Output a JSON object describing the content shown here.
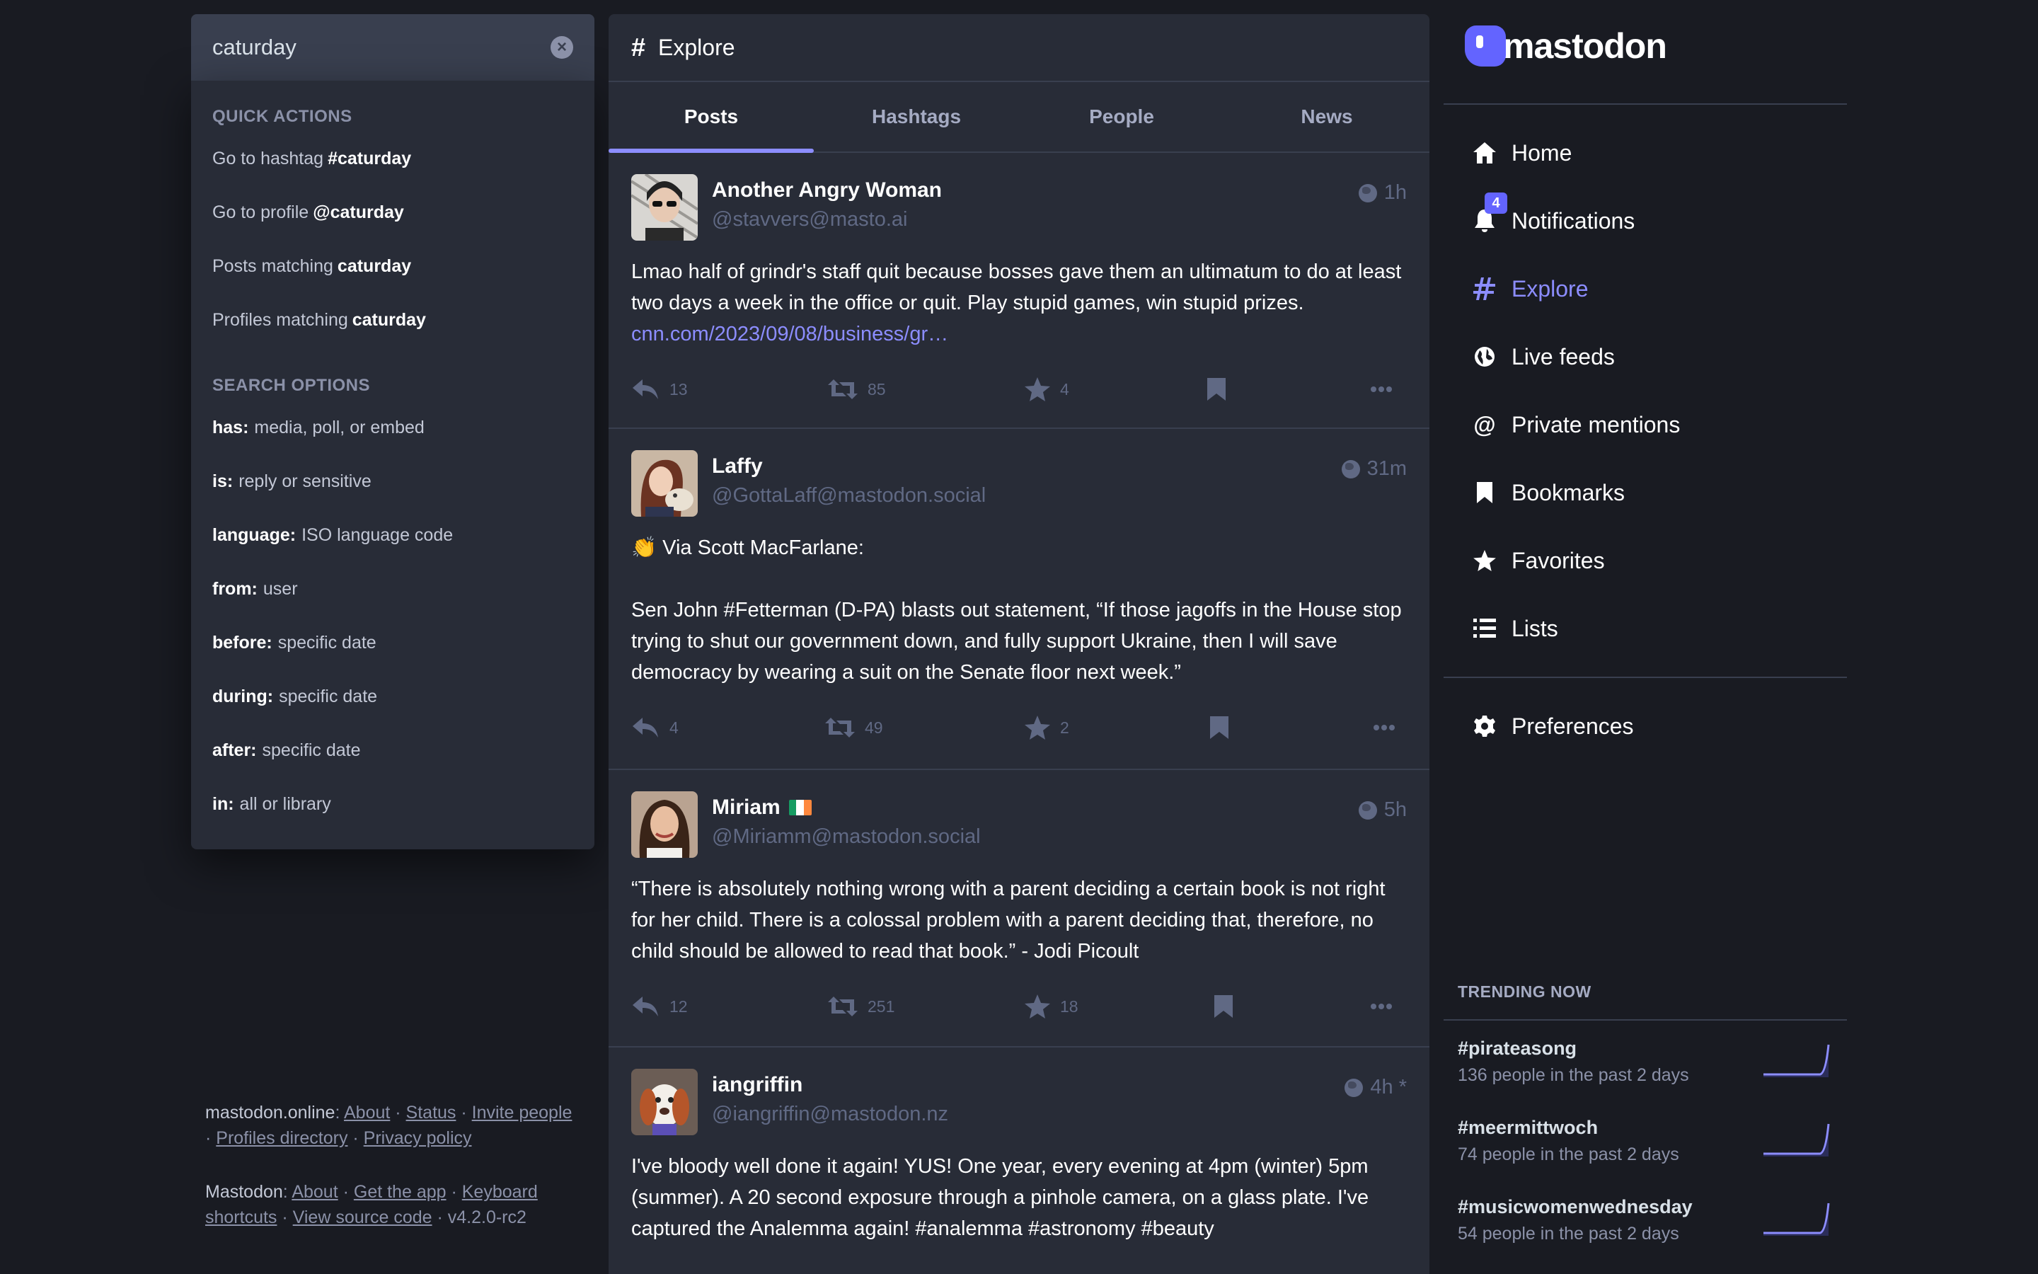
{
  "search": {
    "value": "caturday",
    "quick_actions_heading": "QUICK ACTIONS",
    "quick_actions": [
      {
        "prefix": "Go to hashtag",
        "term": "#caturday"
      },
      {
        "prefix": "Go to profile",
        "term": "@caturday"
      },
      {
        "prefix": "Posts matching",
        "term": "caturday"
      },
      {
        "prefix": "Profiles matching",
        "term": "caturday"
      }
    ],
    "options_heading": "SEARCH OPTIONS",
    "options": [
      {
        "key": "has:",
        "desc": "media, poll, or embed"
      },
      {
        "key": "is:",
        "desc": "reply or sensitive"
      },
      {
        "key": "language:",
        "desc": "ISO language code"
      },
      {
        "key": "from:",
        "desc": "user"
      },
      {
        "key": "before:",
        "desc": "specific date"
      },
      {
        "key": "during:",
        "desc": "specific date"
      },
      {
        "key": "after:",
        "desc": "specific date"
      },
      {
        "key": "in:",
        "desc": "all or library"
      }
    ]
  },
  "footer": {
    "server": "mastodon.online",
    "about": "About",
    "status": "Status",
    "invite": "Invite people",
    "profiles_directory": "Profiles directory",
    "privacy": "Privacy policy",
    "mastodon": "Mastodon",
    "about2": "About",
    "get_app": "Get the app",
    "shortcuts": "Keyboard shortcuts",
    "source": "View source code",
    "version": "v4.2.0-rc2"
  },
  "explore": {
    "title": "Explore",
    "tabs": [
      "Posts",
      "Hashtags",
      "People",
      "News"
    ]
  },
  "posts": [
    {
      "name": "Another Angry Woman",
      "handle": "@stavvers@masto.ai",
      "time": "1h",
      "content": "Lmao half of grindr's staff quit because bosses gave them an ultimatum to do at least two days a week in the office or quit. Play stupid games, win stupid prizes.",
      "link": "cnn.com/2023/09/08/business/gr…",
      "replies": "13",
      "boosts": "85",
      "favs": "4"
    },
    {
      "name": "Laffy",
      "handle": "@GottaLaff@mastodon.social",
      "time": "31m",
      "content_intro": "👏 Via Scott MacFarlane:",
      "content_a": "Sen John ",
      "content_tag": "#Fetterman",
      "content_b": " (D-PA) blasts out statement, “If those jagoffs in the House stop trying to shut our government down, and fully support Ukraine, then I will save democracy by wearing a suit on the Senate floor next week.”",
      "replies": "4",
      "boosts": "49",
      "favs": "2"
    },
    {
      "name": "Miriam",
      "handle": "@Miriamm@mastodon.social",
      "time": "5h",
      "content": "“There is absolutely nothing wrong with a parent deciding a certain book is not right for her child. There is a colossal problem with a parent deciding that, therefore, no child should be allowed to read that book.” - Jodi Picoult",
      "replies": "12",
      "boosts": "251",
      "favs": "18"
    },
    {
      "name": "iangriffin",
      "handle": "@iangriffin@mastodon.nz",
      "time": "4h *",
      "content": "I've bloody well done it again! YUS! One year, every evening at 4pm (winter) 5pm (summer). A 20 second exposure through a pinhole camera, on a glass plate. I've captured the Analemma again! #analemma #astronomy #beauty"
    }
  ],
  "nav": {
    "logo_text": "mastodon",
    "home": "Home",
    "notifications": "Notifications",
    "notifications_badge": "4",
    "explore": "Explore",
    "live_feeds": "Live feeds",
    "private_mentions": "Private mentions",
    "bookmarks": "Bookmarks",
    "favorites": "Favorites",
    "lists": "Lists",
    "preferences": "Preferences"
  },
  "trending": {
    "heading": "TRENDING NOW",
    "items": [
      {
        "tag": "#pirateasong",
        "sub": "136 people in the past 2 days"
      },
      {
        "tag": "#meermittwoch",
        "sub": "74 people in the past 2 days"
      },
      {
        "tag": "#musicwomenwednesday",
        "sub": "54 people in the past 2 days"
      }
    ]
  },
  "colors": {
    "accent": "#8c8dff",
    "brand": "#6364ff",
    "background": "#191b22",
    "panel": "#282c37"
  }
}
